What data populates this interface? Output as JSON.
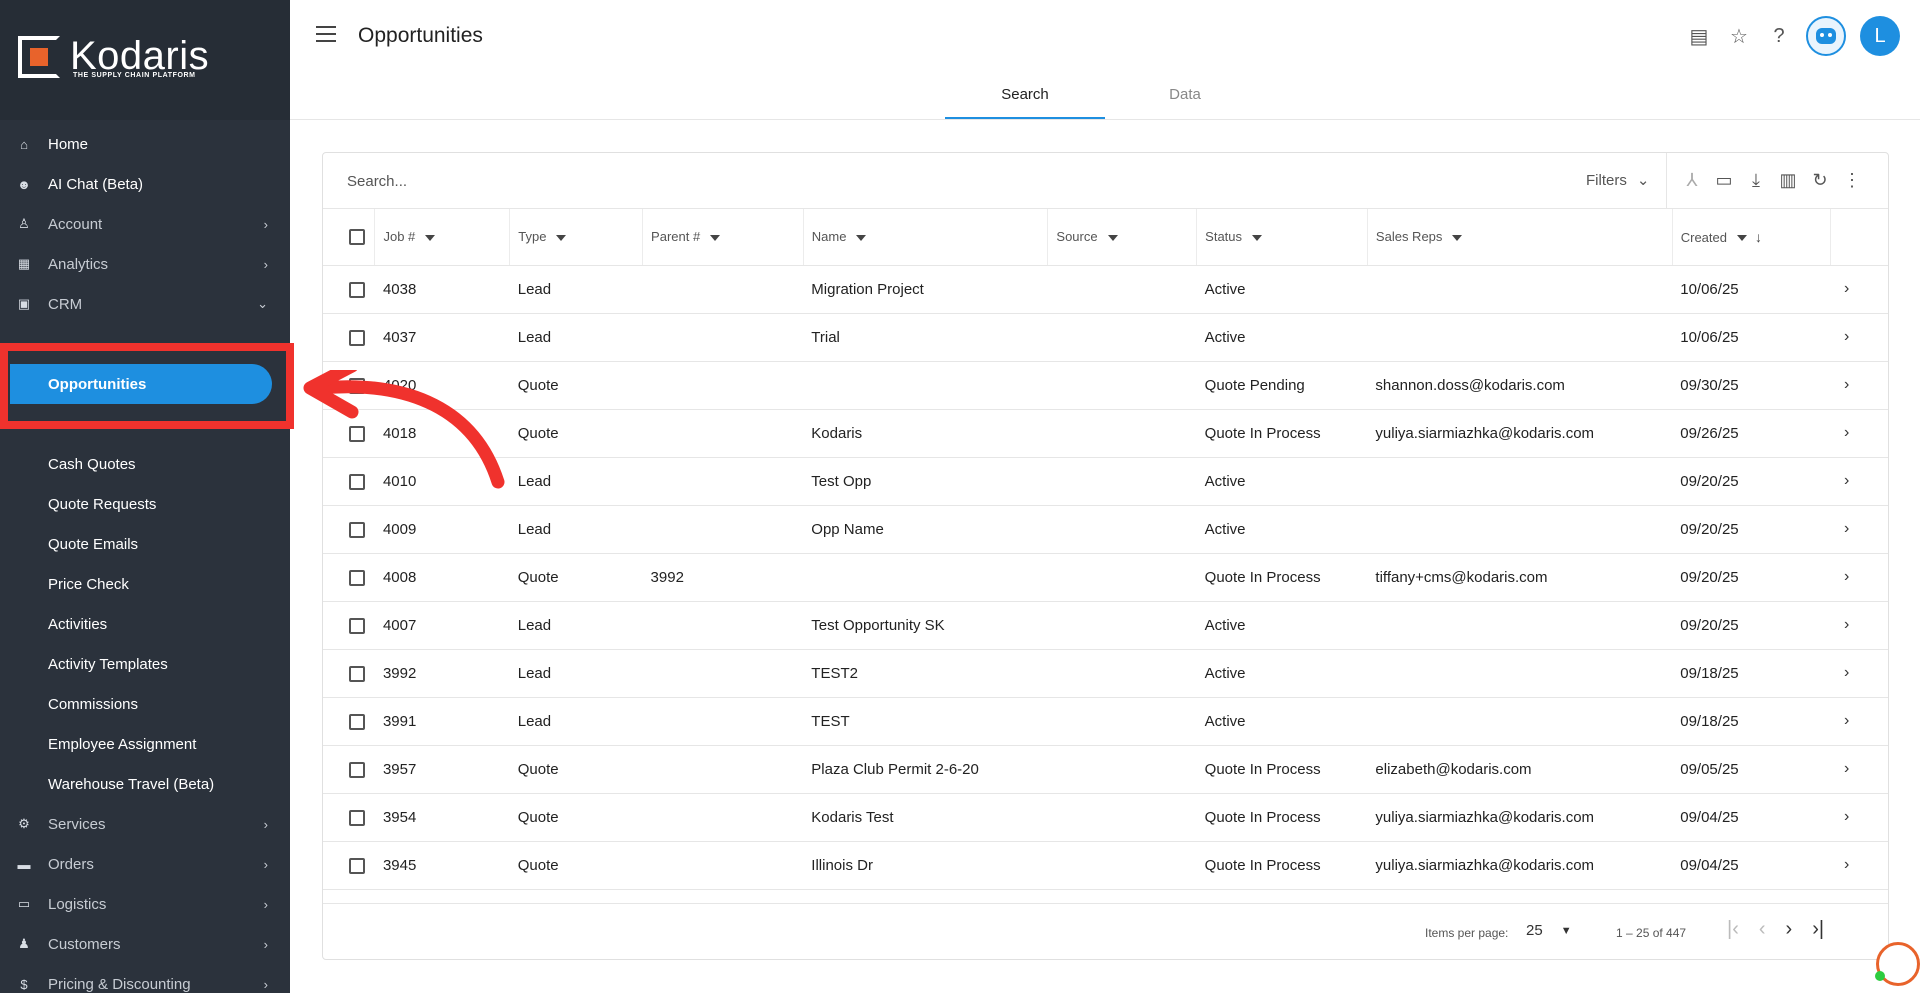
{
  "brand": {
    "name": "Kodaris",
    "tagline": "THE SUPPLY CHAIN PLATFORM"
  },
  "sidebar": {
    "items": [
      {
        "label": "Home",
        "icon": "home-icon"
      },
      {
        "label": "AI Chat (Beta)",
        "icon": "robot-icon"
      },
      {
        "label": "Account",
        "icon": "person-icon"
      },
      {
        "label": "Analytics",
        "icon": "chart-icon"
      },
      {
        "label": "CRM",
        "icon": "contact-card-icon"
      }
    ],
    "crm_sub": [
      "Opportunities",
      "Cash Quotes",
      "Quote Requests",
      "Quote Emails",
      "Price Check",
      "Activities",
      "Activity Templates",
      "Commissions",
      "Employee Assignment",
      "Warehouse Travel (Beta)"
    ],
    "bottom_items": [
      {
        "label": "Services",
        "icon": "gears-icon"
      },
      {
        "label": "Orders",
        "icon": "truck-icon"
      },
      {
        "label": "Logistics",
        "icon": "delivery-icon"
      },
      {
        "label": "Customers",
        "icon": "people-icon"
      },
      {
        "label": "Pricing & Discounting",
        "icon": "dollar-icon"
      }
    ]
  },
  "header": {
    "title": "Opportunities",
    "avatar_initial": "L"
  },
  "tabs": [
    "Search",
    "Data"
  ],
  "search": {
    "placeholder": "Search...",
    "filters_label": "Filters"
  },
  "table": {
    "columns": [
      "Job #",
      "Type",
      "Parent #",
      "Name",
      "Source",
      "Status",
      "Sales Reps",
      "Created"
    ],
    "rows": [
      [
        "4038",
        "Lead",
        "",
        "Migration Project",
        "",
        "Active",
        "",
        "10/06/25"
      ],
      [
        "4037",
        "Lead",
        "",
        "Trial",
        "",
        "Active",
        "",
        "10/06/25"
      ],
      [
        "4020",
        "Quote",
        "",
        "",
        "",
        "Quote Pending",
        "shannon.doss@kodaris.com",
        "09/30/25"
      ],
      [
        "4018",
        "Quote",
        "",
        "Kodaris",
        "",
        "Quote In Process",
        "yuliya.siarmiazhka@kodaris.com",
        "09/26/25"
      ],
      [
        "4010",
        "Lead",
        "",
        "Test Opp",
        "",
        "Active",
        "",
        "09/20/25"
      ],
      [
        "4009",
        "Lead",
        "",
        "Opp Name",
        "",
        "Active",
        "",
        "09/20/25"
      ],
      [
        "4008",
        "Quote",
        "3992",
        "",
        "",
        "Quote In Process",
        "tiffany+cms@kodaris.com",
        "09/20/25"
      ],
      [
        "4007",
        "Lead",
        "",
        "Test Opportunity SK",
        "",
        "Active",
        "",
        "09/20/25"
      ],
      [
        "3992",
        "Lead",
        "",
        "TEST2",
        "",
        "Active",
        "",
        "09/18/25"
      ],
      [
        "3991",
        "Lead",
        "",
        "TEST",
        "",
        "Active",
        "",
        "09/18/25"
      ],
      [
        "3957",
        "Quote",
        "",
        "Plaza Club Permit 2-6-20",
        "",
        "Quote In Process",
        "elizabeth@kodaris.com",
        "09/05/25"
      ],
      [
        "3954",
        "Quote",
        "",
        "Kodaris Test",
        "",
        "Quote In Process",
        "yuliya.siarmiazhka@kodaris.com",
        "09/04/25"
      ],
      [
        "3945",
        "Quote",
        "",
        "Illinois Dr",
        "",
        "Quote In Process",
        "yuliya.siarmiazhka@kodaris.com",
        "09/04/25"
      ]
    ]
  },
  "pager": {
    "items_per_page_label": "Items per page:",
    "page_size": "25",
    "range": "1 – 25 of 447"
  },
  "colors": {
    "accent": "#1e8fe0",
    "sidebar": "#2b323c",
    "highlight": "#f0322d",
    "brand_orange": "#e8632b"
  }
}
